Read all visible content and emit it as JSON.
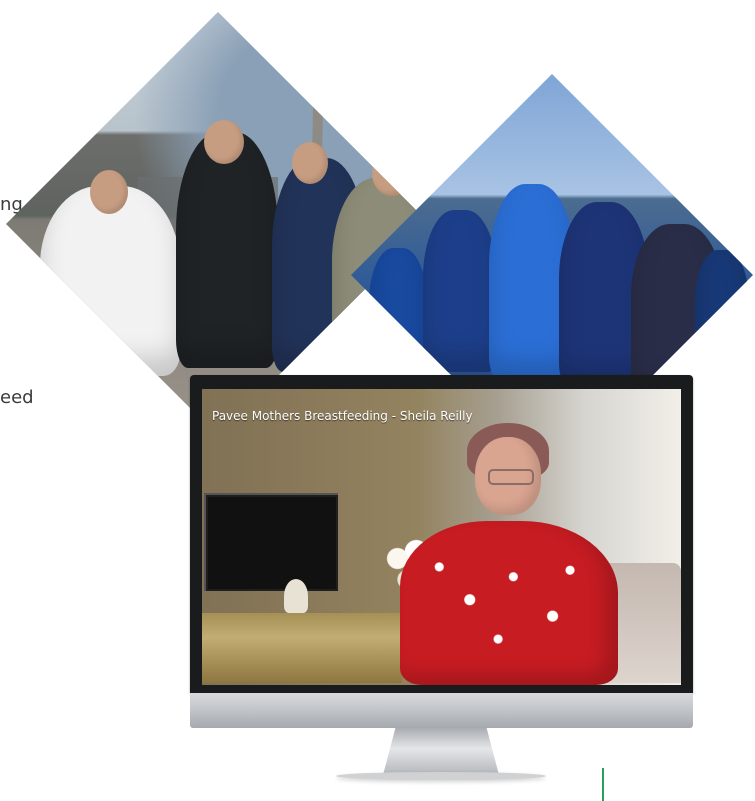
{
  "left_text_fragments": [
    "ng",
    "eed"
  ],
  "video": {
    "title": "Pavee Mothers Breastfeeding - Sheila Reilly"
  },
  "colors": {
    "accent": "#2a9d61",
    "monitor_bezel": "#1a1b1d",
    "monitor_chin": "#c3c6ca"
  },
  "icons": {
    "monitor": "desktop-monitor-icon"
  }
}
